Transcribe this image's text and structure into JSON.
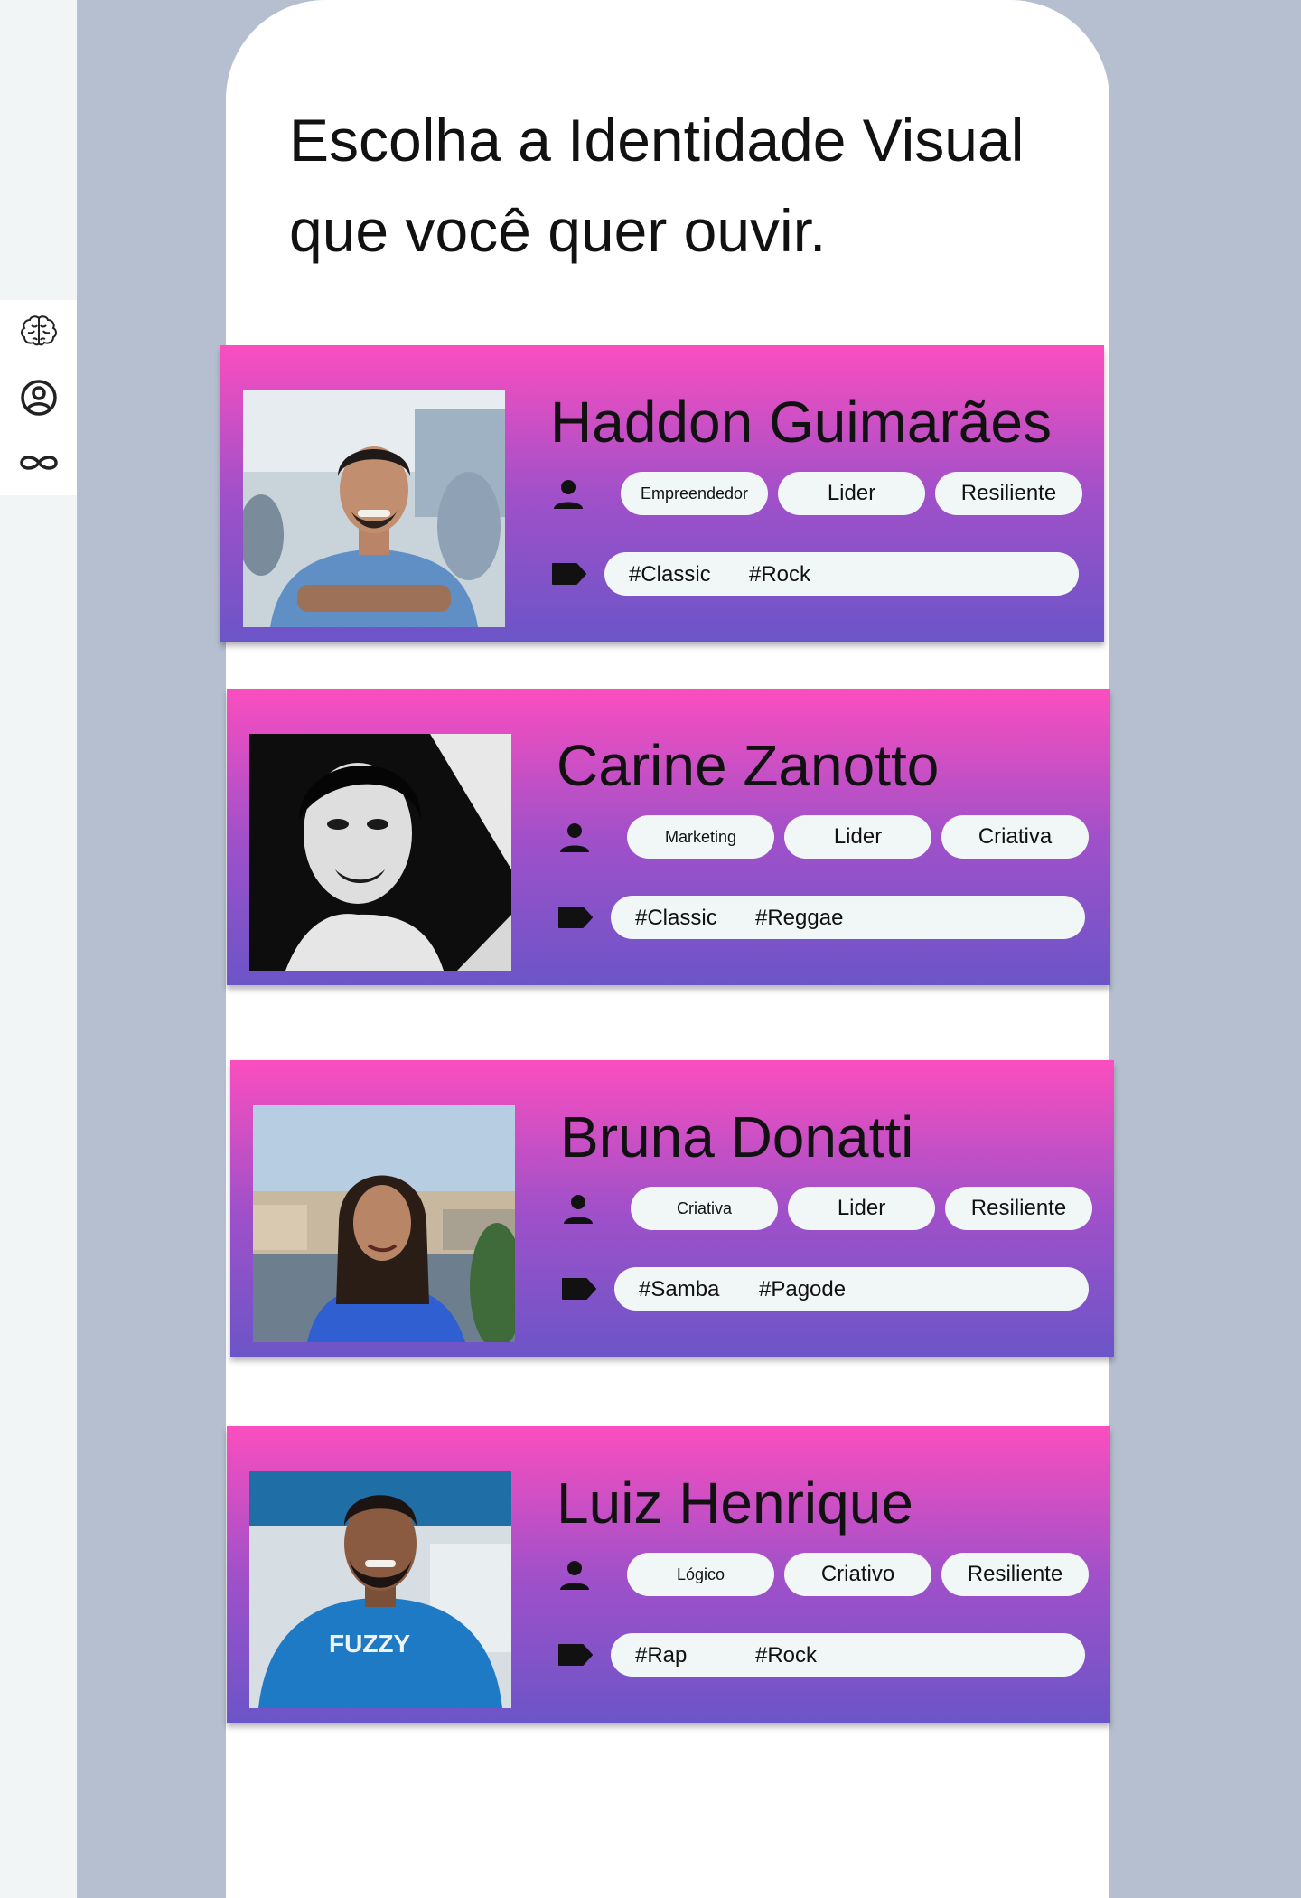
{
  "sidebar": {
    "items": [
      {
        "icon": "brain-icon"
      },
      {
        "icon": "user-circle-icon"
      },
      {
        "icon": "infinity-icon"
      }
    ]
  },
  "page": {
    "title_line1": "Escolha a Identidade Visual",
    "title_line2": "que você quer ouvir."
  },
  "cards": [
    {
      "name": "Haddon Guimarães",
      "traits": [
        "Empreendedor",
        "Lider",
        "Resiliente"
      ],
      "tags": [
        "#Classic",
        "#Rock"
      ],
      "photo": "man-blue-shirt-photo"
    },
    {
      "name": "Carine Zanotto",
      "traits": [
        "Marketing",
        "Lider",
        "Criativa"
      ],
      "tags": [
        "#Classic",
        "#Reggae"
      ],
      "photo": "woman-black-white-photo"
    },
    {
      "name": "Bruna Donatti",
      "traits": [
        "Criativa",
        "Lider",
        "Resiliente"
      ],
      "tags": [
        "#Samba",
        "#Pagode"
      ],
      "photo": "woman-riverside-photo"
    },
    {
      "name": "Luiz Henrique",
      "traits": [
        "Lógico",
        "Criativo",
        "Resiliente"
      ],
      "tags": [
        "#Rap",
        "#Rock"
      ],
      "photo": "man-fuzzy-shirt-photo"
    }
  ],
  "photo_labels": {
    "card3_shirt_text": "FUZZY"
  },
  "colors": {
    "card_gradient_top": "#fb4ebf",
    "card_gradient_bottom": "#6b55c8",
    "pill_bg": "#f1f6f6",
    "background": "#b5bfcf"
  }
}
